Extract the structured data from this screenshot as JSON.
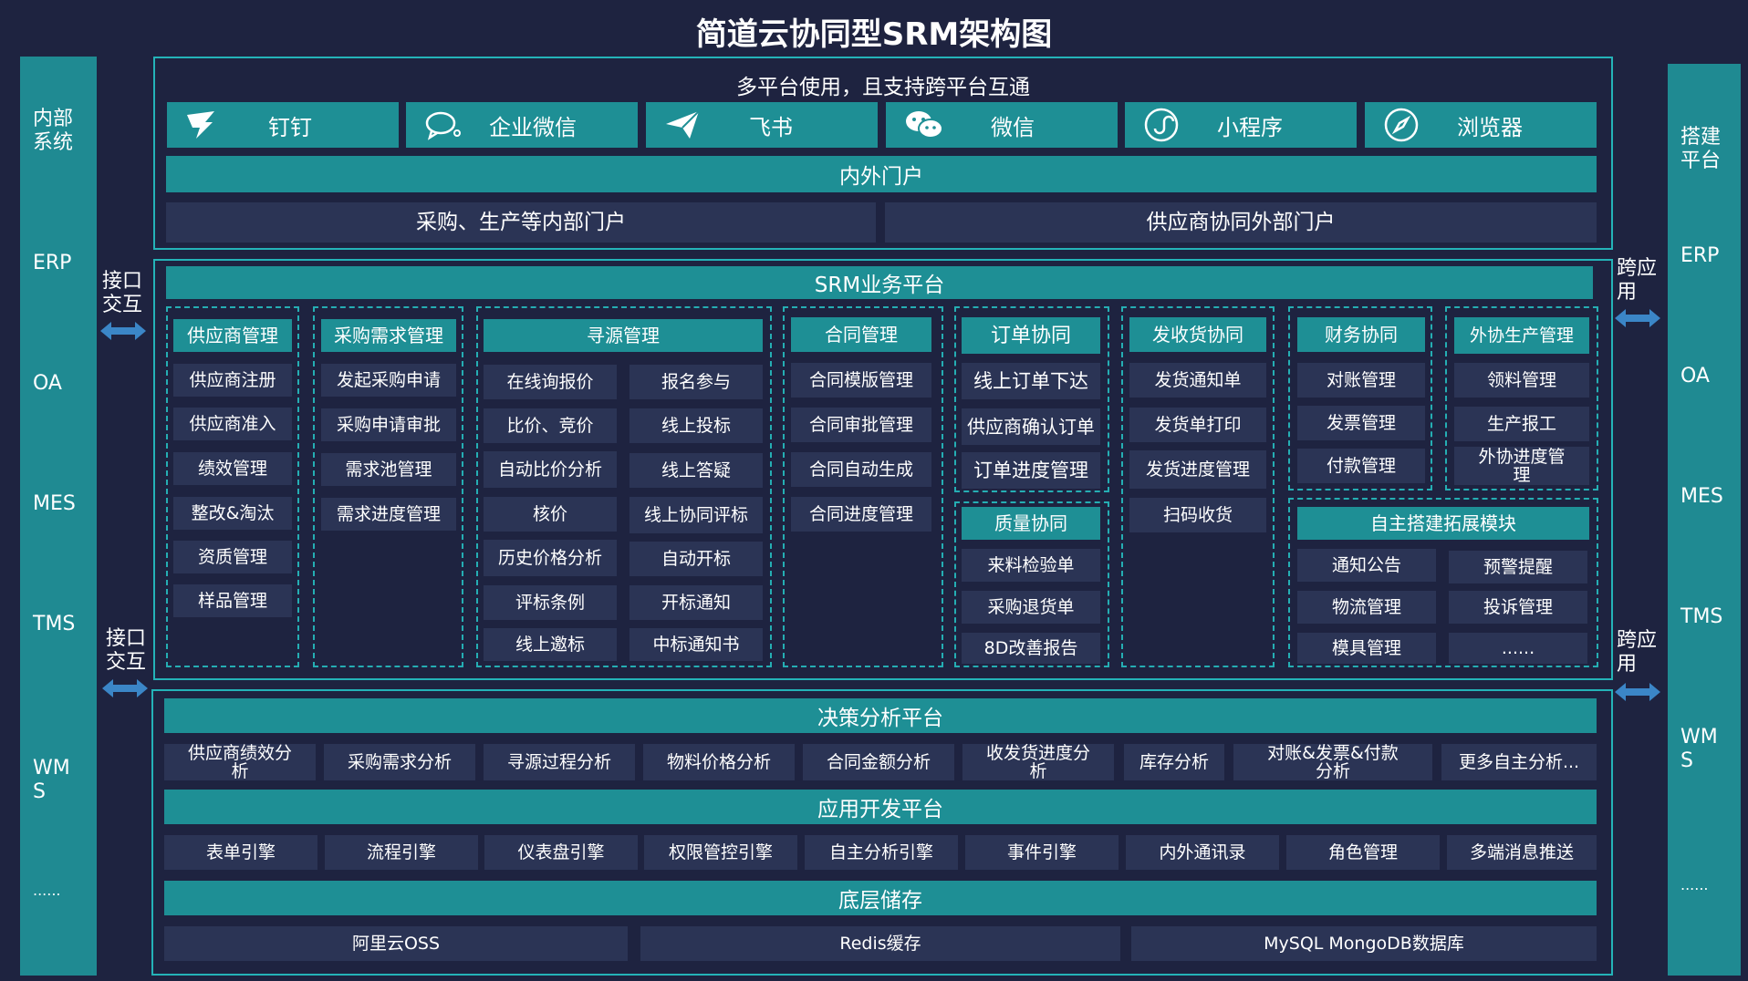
{
  "title": "简道云协同型SRM架构图",
  "left_col": {
    "items": [
      "内部系统",
      "ERP",
      "OA",
      "MES",
      "TMS",
      "WMS",
      "......"
    ]
  },
  "right_col": {
    "items": [
      "搭建平台",
      "ERP",
      "OA",
      "MES",
      "TMS",
      "WMS",
      "......"
    ]
  },
  "interface_labels": {
    "left_top": "接口交互",
    "left_bottom": "接口交互",
    "right_top": "跨应用",
    "right_bottom": "跨应用"
  },
  "platform": {
    "heading": "多平台使用，且支持跨平台互通",
    "apps": [
      {
        "label": "钉钉",
        "icon": "dingtalk-icon"
      },
      {
        "label": "企业微信",
        "icon": "wecom-icon"
      },
      {
        "label": "飞书",
        "icon": "feishu-icon"
      },
      {
        "label": "微信",
        "icon": "wechat-icon"
      },
      {
        "label": "小程序",
        "icon": "miniprogram-icon"
      },
      {
        "label": "浏览器",
        "icon": "browser-icon"
      }
    ],
    "portal_bar": "内外门户",
    "portal_internal": "采购、生产等内部门户",
    "portal_external": "供应商协同外部门户"
  },
  "srm": {
    "heading": "SRM业务平台",
    "supplier": {
      "head": "供应商管理",
      "items": [
        "供应商注册",
        "供应商准入",
        "绩效管理",
        "整改&淘汰",
        "资质管理",
        "样品管理"
      ]
    },
    "demand": {
      "head": "采购需求管理",
      "items": [
        "发起采购申请",
        "采购申请审批",
        "需求池管理",
        "需求进度管理"
      ]
    },
    "sourcing": {
      "head": "寻源管理",
      "left": [
        "在线询报价",
        "比价、竞价",
        "自动比价分析",
        "核价",
        "历史价格分析",
        "评标条例",
        "线上邀标"
      ],
      "right": [
        "报名参与",
        "线上投标",
        "线上答疑",
        "线上协同评标",
        "自动开标",
        "开标通知",
        "中标通知书"
      ]
    },
    "contract": {
      "head": "合同管理",
      "items": [
        "合同模版管理",
        "合同审批管理",
        "合同自动生成",
        "合同进度管理"
      ]
    },
    "order": {
      "head": "订单协同",
      "items": [
        "线上订单下达",
        "供应商确认订单",
        "订单进度管理"
      ]
    },
    "quality": {
      "head": "质量协同",
      "items": [
        "来料检验单",
        "采购退货单",
        "8D改善报告"
      ]
    },
    "delivery": {
      "head": "发收货协同",
      "items": [
        "发货通知单",
        "发货单打印",
        "发货进度管理",
        "扫码收货"
      ]
    },
    "finance": {
      "head": "财务协同",
      "items": [
        "对账管理",
        "发票管理",
        "付款管理"
      ]
    },
    "outsource": {
      "head": "外协生产管理",
      "items": [
        "领料管理",
        "生产报工",
        "外协进度管理"
      ]
    },
    "custom": {
      "head": "自主搭建拓展模块",
      "left": [
        "通知公告",
        "物流管理",
        "模具管理"
      ],
      "right": [
        "预警提醒",
        "投诉管理",
        "......"
      ]
    }
  },
  "decision": {
    "heading": "决策分析平台",
    "items": [
      "供应商绩效分析",
      "采购需求分析",
      "寻源过程分析",
      "物料价格分析",
      "合同金额分析",
      "收发货进度分析",
      "库存分析",
      "对账&发票&付款分析",
      "更多自主分析..."
    ]
  },
  "appdev": {
    "heading": "应用开发平台",
    "items": [
      "表单引擎",
      "流程引擎",
      "仪表盘引擎",
      "权限管控引擎",
      "自主分析引擎",
      "事件引擎",
      "内外通讯录",
      "角色管理",
      "多端消息推送"
    ]
  },
  "storage": {
    "heading": "底层储存",
    "items": [
      "阿里云OSS",
      "Redis缓存",
      "MySQL MongoDB数据库"
    ]
  }
}
